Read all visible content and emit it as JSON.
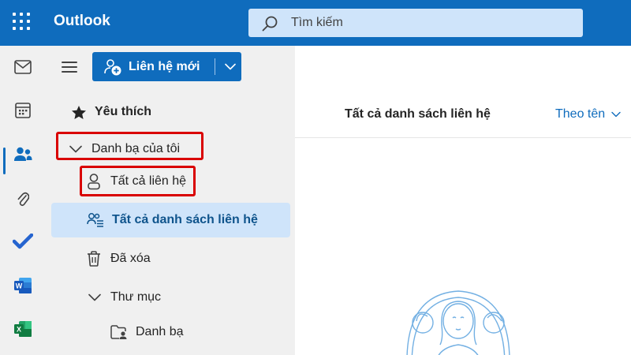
{
  "header": {
    "app_title": "Outlook",
    "search_placeholder": "Tìm kiếm",
    "brand_color": "#0f6cbd"
  },
  "rail": {
    "items": [
      {
        "name": "mail-icon"
      },
      {
        "name": "calendar-icon"
      },
      {
        "name": "people-icon",
        "active": true
      },
      {
        "name": "attachment-icon"
      },
      {
        "name": "todo-icon"
      },
      {
        "name": "word-icon"
      },
      {
        "name": "excel-icon"
      }
    ]
  },
  "toolbar": {
    "new_contact_label": "Liên hệ mới"
  },
  "folders": {
    "favorites": "Yêu thích",
    "my_contacts": "Danh bạ của tôi",
    "all_contacts": "Tất cả liên hệ",
    "all_contact_lists": "Tất cả danh sách liên hệ",
    "deleted": "Đã xóa",
    "folders_group": "Thư mục",
    "contacts_folder": "Danh bạ",
    "selected": "Tất cả danh sách liên hệ"
  },
  "main": {
    "title": "Tất cả danh sách liên hệ",
    "sort_label": "Theo tên"
  },
  "colors": {
    "highlight_box": "#d90000",
    "selected_bg": "#cfe4fa"
  }
}
